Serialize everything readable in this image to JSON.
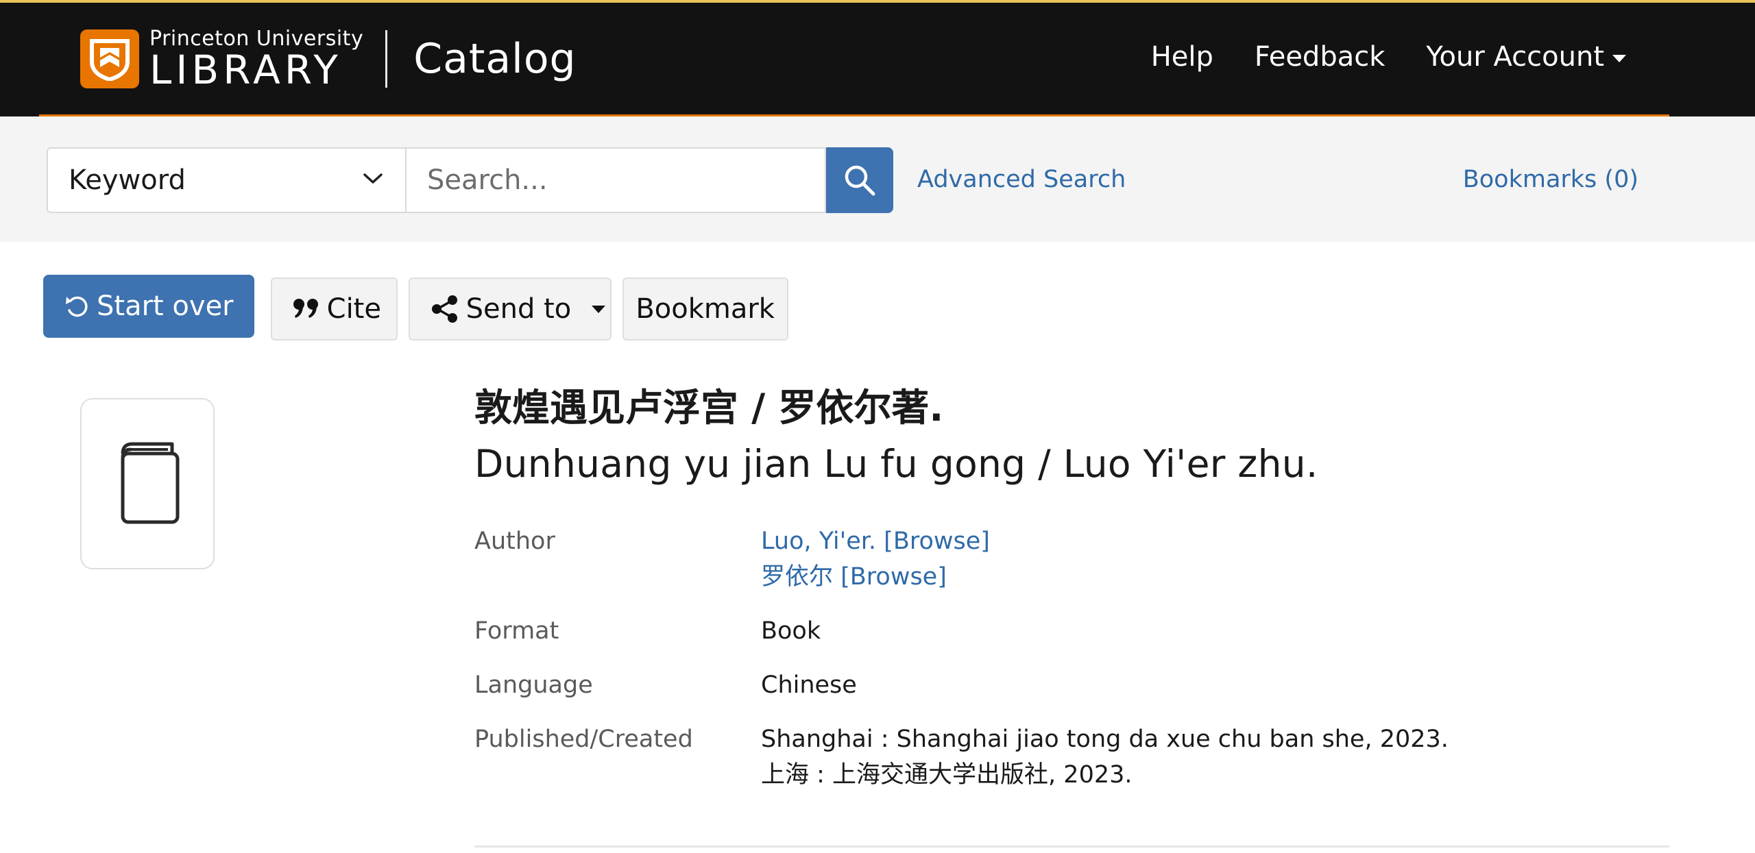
{
  "header": {
    "brand_top": "Princeton University",
    "brand_main": "LIBRARY",
    "catalog": "Catalog",
    "nav": {
      "help": "Help",
      "feedback": "Feedback",
      "account": "Your Account"
    },
    "accent_color": "#e77500"
  },
  "search": {
    "field_select": "Keyword",
    "input_placeholder": "Search...",
    "advanced_link": "Advanced Search",
    "bookmarks_link": "Bookmarks (0)",
    "button_color": "#3e72b0"
  },
  "toolbar": {
    "start_over": "Start over",
    "cite": "Cite",
    "send_to": "Send to",
    "bookmark": "Bookmark"
  },
  "record": {
    "title_cn": "敦煌遇见卢浮宫 / 罗依尔著.",
    "title_en": "Dunhuang yu jian Lu fu gong / Luo Yi'er zhu.",
    "thumbnail_icon": "book-icon",
    "fields": [
      {
        "label": "Author",
        "values": [
          "Luo, Yi'er. [Browse]",
          "罗依尔 [Browse]"
        ]
      },
      {
        "label": "Format",
        "values": [
          "Book"
        ]
      },
      {
        "label": "Language",
        "values": [
          "Chinese"
        ]
      },
      {
        "label": "Published/Created",
        "values": [
          "Shanghai : Shanghai jiao tong da xue chu ban she, 2023.",
          "上海 : 上海交通大学出版社, 2023."
        ]
      }
    ]
  }
}
